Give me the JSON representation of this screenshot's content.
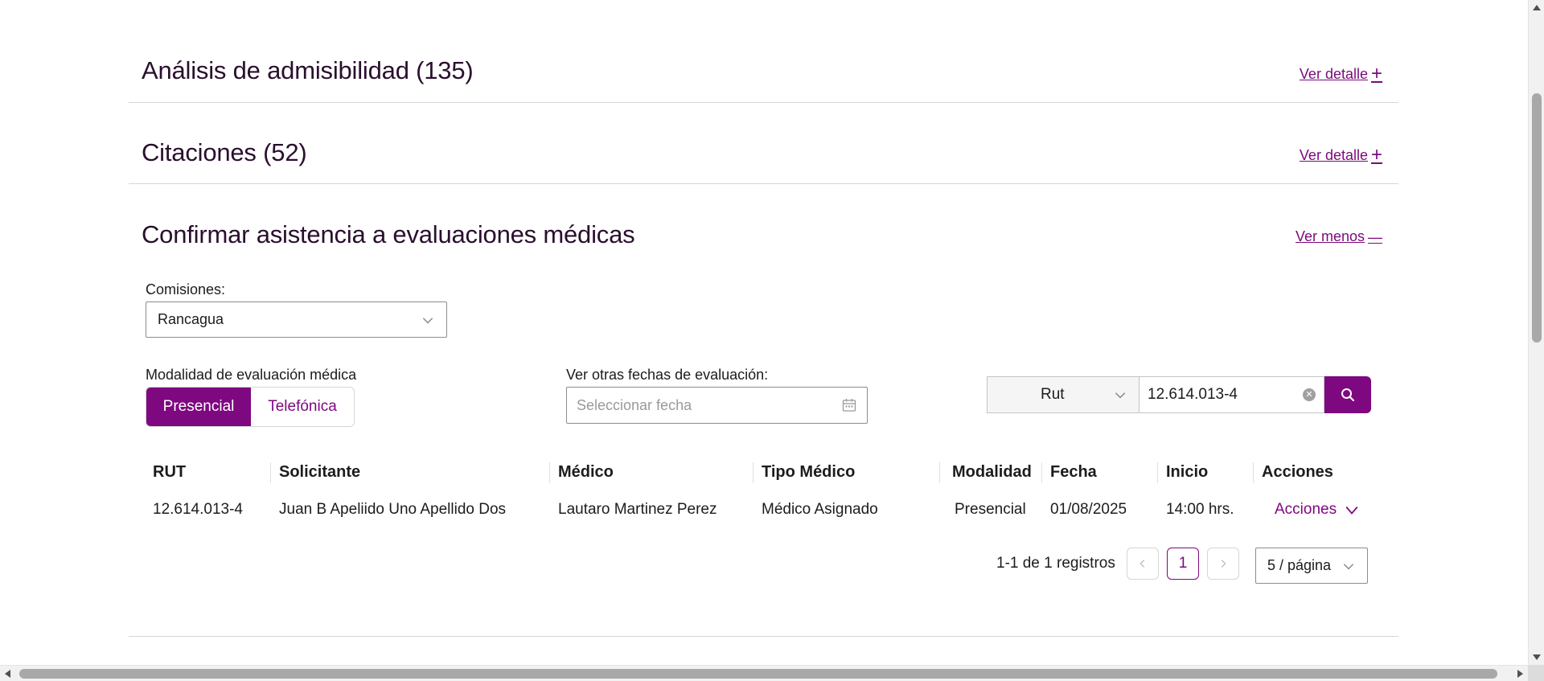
{
  "sections": {
    "admisibilidad": {
      "title": "Análisis de admisibilidad (135)",
      "link": "Ver detalle",
      "link_symbol": "+"
    },
    "citaciones": {
      "title": "Citaciones (52)",
      "link": "Ver detalle",
      "link_symbol": "+"
    },
    "confirmar": {
      "title": "Confirmar asistencia a evaluaciones médicas",
      "link": "Ver menos",
      "link_symbol": "—"
    }
  },
  "filters": {
    "comisiones_label": "Comisiones:",
    "comisiones_value": "Rancagua",
    "modalidad_label": "Modalidad de evaluación médica",
    "modalidad_options": [
      "Presencial",
      "Telefónica"
    ],
    "modalidad_selected": "Presencial",
    "fecha_label": "Ver otras fechas de evaluación:",
    "fecha_placeholder": "Seleccionar fecha",
    "search_type": "Rut",
    "search_value": "12.614.013-4"
  },
  "table": {
    "headers": [
      "RUT",
      "Solicitante",
      "Médico",
      "Tipo Médico",
      "Modalidad",
      "Fecha",
      "Inicio",
      "Acciones"
    ],
    "rows": [
      {
        "rut": "12.614.013-4",
        "solicitante": "Juan B Apeliido Uno Apellido Dos",
        "medico": "Lautaro Martinez Perez",
        "tipo_medico": "Médico Asignado",
        "modalidad": "Presencial",
        "fecha": "01/08/2025",
        "inicio": "14:00 hrs.",
        "acciones": "Acciones"
      }
    ]
  },
  "pagination": {
    "summary": "1-1 de 1 registros",
    "current_page": "1",
    "page_size": "5 / página"
  },
  "icons": {
    "search": "search-icon",
    "calendar": "calendar-icon",
    "chevron": "chevron-down-icon",
    "clear": "clear-icon"
  },
  "colors": {
    "accent": "#7e0880",
    "title": "#2a0f2e",
    "divider": "#d6d6d6"
  }
}
